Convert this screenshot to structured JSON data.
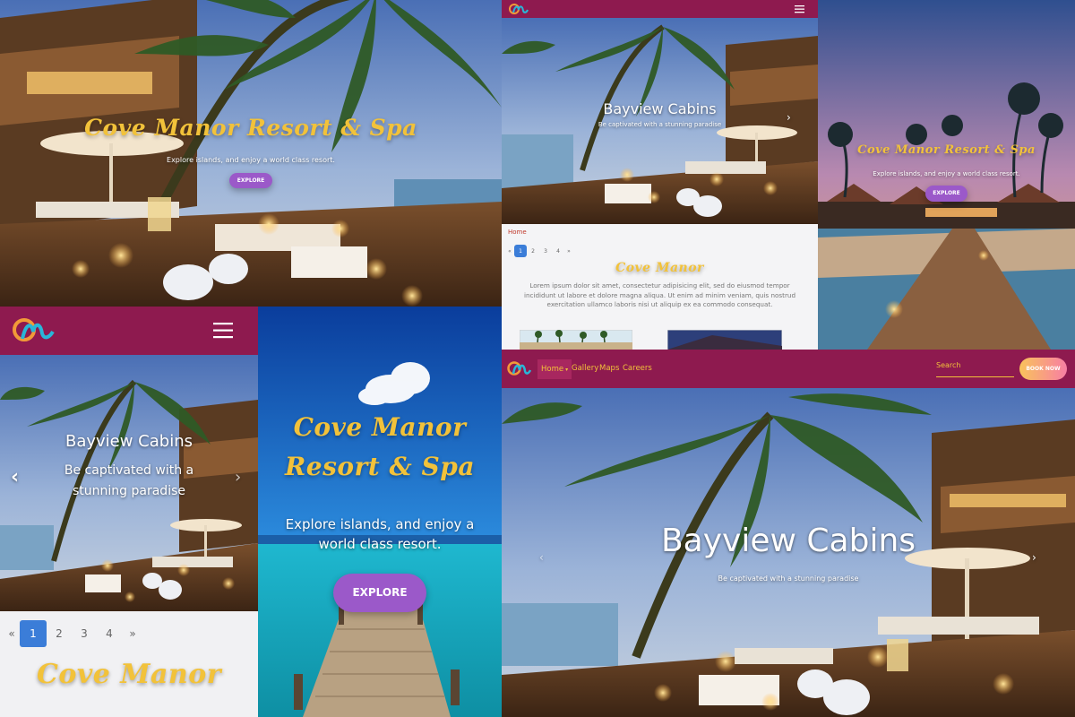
{
  "brand": {
    "accent": "#8e1a4f",
    "gold": "#f2c23a",
    "purple": "#9b59c9",
    "active_blue": "#3b7dd8",
    "book_gradient": [
      "#f9c35b",
      "#f77ea4"
    ]
  },
  "hero1": {
    "title": "Cove Manor Resort & Spa",
    "subtitle": "Explore islands, and enjoy a world class resort.",
    "button": "EXPLORE"
  },
  "tablet": {
    "carousel_title": "Bayview Cabins",
    "carousel_subtitle": "Be captivated with a stunning paradise",
    "breadcrumb": "Home",
    "pagination": [
      "«",
      "1",
      "2",
      "3",
      "4",
      "»"
    ],
    "section_title": "Cove Manor",
    "body": "Lorem ipsum dolor sit amet, consectetur adipisicing elit, sed do eiusmod tempor incididunt ut labore et dolore magna aliqua. Ut enim ad minim veniam, quis nostrud exercitation ullamco laboris nisi ut aliquip ex ea commodo consequat."
  },
  "sunset": {
    "title": "Cove Manor Resort & Spa",
    "subtitle": "Explore islands, and enjoy a world class resort.",
    "button": "EXPLORE"
  },
  "phone": {
    "carousel_title": "Bayview Cabins",
    "carousel_subtitle": "Be captivated with a stunning paradise",
    "pagination": [
      "«",
      "1",
      "2",
      "3",
      "4",
      "»"
    ],
    "section_title": "Cove Manor"
  },
  "dock": {
    "title": "Cove Manor Resort & Spa",
    "subtitle": "Explore islands, and enjoy a world class resort.",
    "button": "EXPLORE"
  },
  "desktop": {
    "nav": [
      "Home",
      "Gallery",
      "Maps",
      "Careers"
    ],
    "search_placeholder": "Search",
    "book_button": "BOOK NOW",
    "carousel_title": "Bayview Cabins",
    "carousel_subtitle": "Be captivated with a stunning paradise"
  },
  "icons": {
    "logo": "logo-icon",
    "menu": "hamburger-icon",
    "prev": "chevron-left-icon",
    "next": "chevron-right-icon",
    "caret": "caret-down-icon"
  }
}
